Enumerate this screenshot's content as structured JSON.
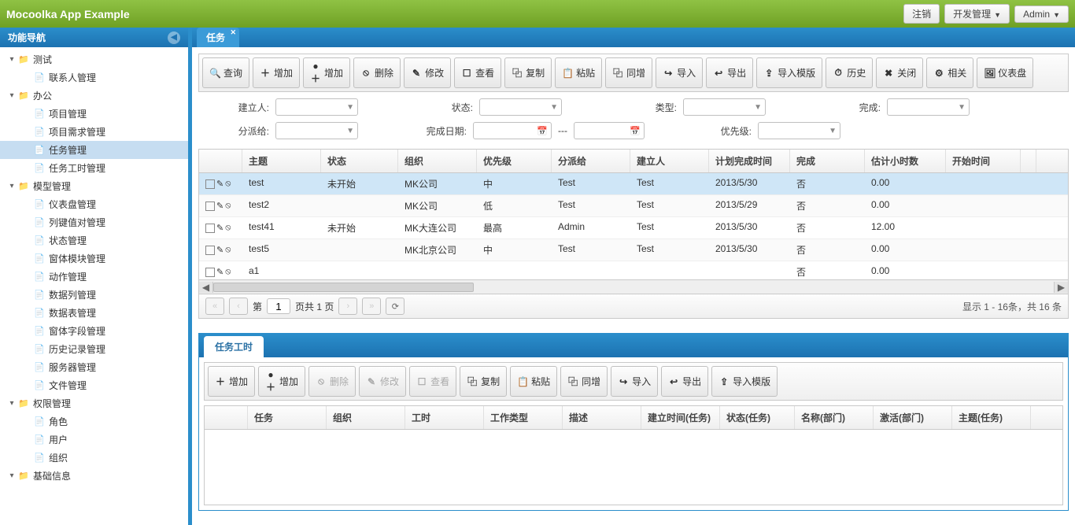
{
  "header": {
    "app_title": "Mocoolka App Example",
    "logout": "注销",
    "dev_mgmt": "开发管理",
    "admin": "Admin"
  },
  "sidebar": {
    "title": "功能导航",
    "nodes": [
      {
        "label": "测试",
        "type": "folder",
        "indent": 0,
        "open": true
      },
      {
        "label": "联系人管理",
        "type": "file",
        "indent": 1
      },
      {
        "label": "办公",
        "type": "folder",
        "indent": 0,
        "open": true
      },
      {
        "label": "项目管理",
        "type": "file",
        "indent": 1
      },
      {
        "label": "项目需求管理",
        "type": "file",
        "indent": 1
      },
      {
        "label": "任务管理",
        "type": "file",
        "indent": 1,
        "selected": true
      },
      {
        "label": "任务工时管理",
        "type": "file",
        "indent": 1
      },
      {
        "label": "模型管理",
        "type": "folder",
        "indent": 0,
        "open": true
      },
      {
        "label": "仪表盘管理",
        "type": "file",
        "indent": 1
      },
      {
        "label": "列键值对管理",
        "type": "file",
        "indent": 1
      },
      {
        "label": "状态管理",
        "type": "file",
        "indent": 1
      },
      {
        "label": "窗体模块管理",
        "type": "file",
        "indent": 1
      },
      {
        "label": "动作管理",
        "type": "file",
        "indent": 1
      },
      {
        "label": "数据列管理",
        "type": "file",
        "indent": 1
      },
      {
        "label": "数据表管理",
        "type": "file",
        "indent": 1
      },
      {
        "label": "窗体字段管理",
        "type": "file",
        "indent": 1
      },
      {
        "label": "历史记录管理",
        "type": "file",
        "indent": 1
      },
      {
        "label": "服务器管理",
        "type": "file",
        "indent": 1
      },
      {
        "label": "文件管理",
        "type": "file",
        "indent": 1
      },
      {
        "label": "权限管理",
        "type": "folder",
        "indent": 0,
        "open": true
      },
      {
        "label": "角色",
        "type": "file",
        "indent": 1
      },
      {
        "label": "用户",
        "type": "file",
        "indent": 1
      },
      {
        "label": "组织",
        "type": "file",
        "indent": 1
      },
      {
        "label": "基础信息",
        "type": "folder",
        "indent": 0,
        "open": true
      }
    ]
  },
  "tab": {
    "title": "任务"
  },
  "toolbar_main": [
    "查询",
    "增加",
    "增加",
    "删除",
    "修改",
    "查看",
    "复制",
    "粘贴",
    "同增",
    "导入",
    "导出",
    "导入模版",
    "历史",
    "关闭",
    "相关",
    "仪表盘"
  ],
  "toolbar_icons_main": [
    "🔍",
    "＋",
    "●＋",
    "⦸",
    "✎",
    "☐",
    "⿻",
    "📋",
    "⿻",
    "↪",
    "↩",
    "⇪",
    "⏱",
    "✖",
    "⚙",
    "🖼"
  ],
  "filters": {
    "creator": "建立人:",
    "status": "状态:",
    "type": "类型:",
    "done": "完成:",
    "assign": "分派给:",
    "done_date": "完成日期:",
    "dash": "---",
    "priority": "优先级:"
  },
  "grid": {
    "headers": [
      "主题",
      "状态",
      "组织",
      "优先级",
      "分派给",
      "建立人",
      "计划完成时间",
      "完成",
      "估计小时数",
      "开始时间"
    ],
    "rows": [
      {
        "subject": "test",
        "status": "未开始",
        "org": "MK公司",
        "priority": "中",
        "assign": "Test",
        "creator": "Test",
        "plan": "2013/5/30",
        "done": "否",
        "est": "0.00",
        "start": "",
        "sel": true
      },
      {
        "subject": "test2",
        "status": "",
        "org": "MK公司",
        "priority": "低",
        "assign": "Test",
        "creator": "Test",
        "plan": "2013/5/29",
        "done": "否",
        "est": "0.00",
        "start": ""
      },
      {
        "subject": "test41",
        "status": "未开始",
        "org": "MK大连公司",
        "priority": "最高",
        "assign": "Admin",
        "creator": "Test",
        "plan": "2013/5/30",
        "done": "否",
        "est": "12.00",
        "start": ""
      },
      {
        "subject": "test5",
        "status": "",
        "org": "MK北京公司",
        "priority": "中",
        "assign": "Test",
        "creator": "Test",
        "plan": "2013/5/30",
        "done": "否",
        "est": "0.00",
        "start": ""
      },
      {
        "subject": "a1",
        "status": "",
        "org": "",
        "priority": "",
        "assign": "",
        "creator": "",
        "plan": "",
        "done": "否",
        "est": "0.00",
        "start": ""
      }
    ]
  },
  "pager": {
    "page_label_pre": "第",
    "page": "1",
    "page_label_post": "页共 1 页",
    "info": "显示 1 - 16条，共 16 条"
  },
  "sub": {
    "tab": "任务工时",
    "toolbar": [
      "增加",
      "增加",
      "删除",
      "修改",
      "查看",
      "复制",
      "粘贴",
      "同增",
      "导入",
      "导出",
      "导入模版"
    ],
    "toolbar_icons": [
      "＋",
      "●＋",
      "⦸",
      "✎",
      "☐",
      "⿻",
      "📋",
      "⿻",
      "↪",
      "↩",
      "⇪"
    ],
    "disabled": [
      false,
      false,
      true,
      true,
      true,
      false,
      false,
      false,
      false,
      false,
      false
    ],
    "headers": [
      "任务",
      "组织",
      "工时",
      "工作类型",
      "描述",
      "建立时间(任务)",
      "状态(任务)",
      "名称(部门)",
      "激活(部门)",
      "主题(任务)"
    ]
  }
}
